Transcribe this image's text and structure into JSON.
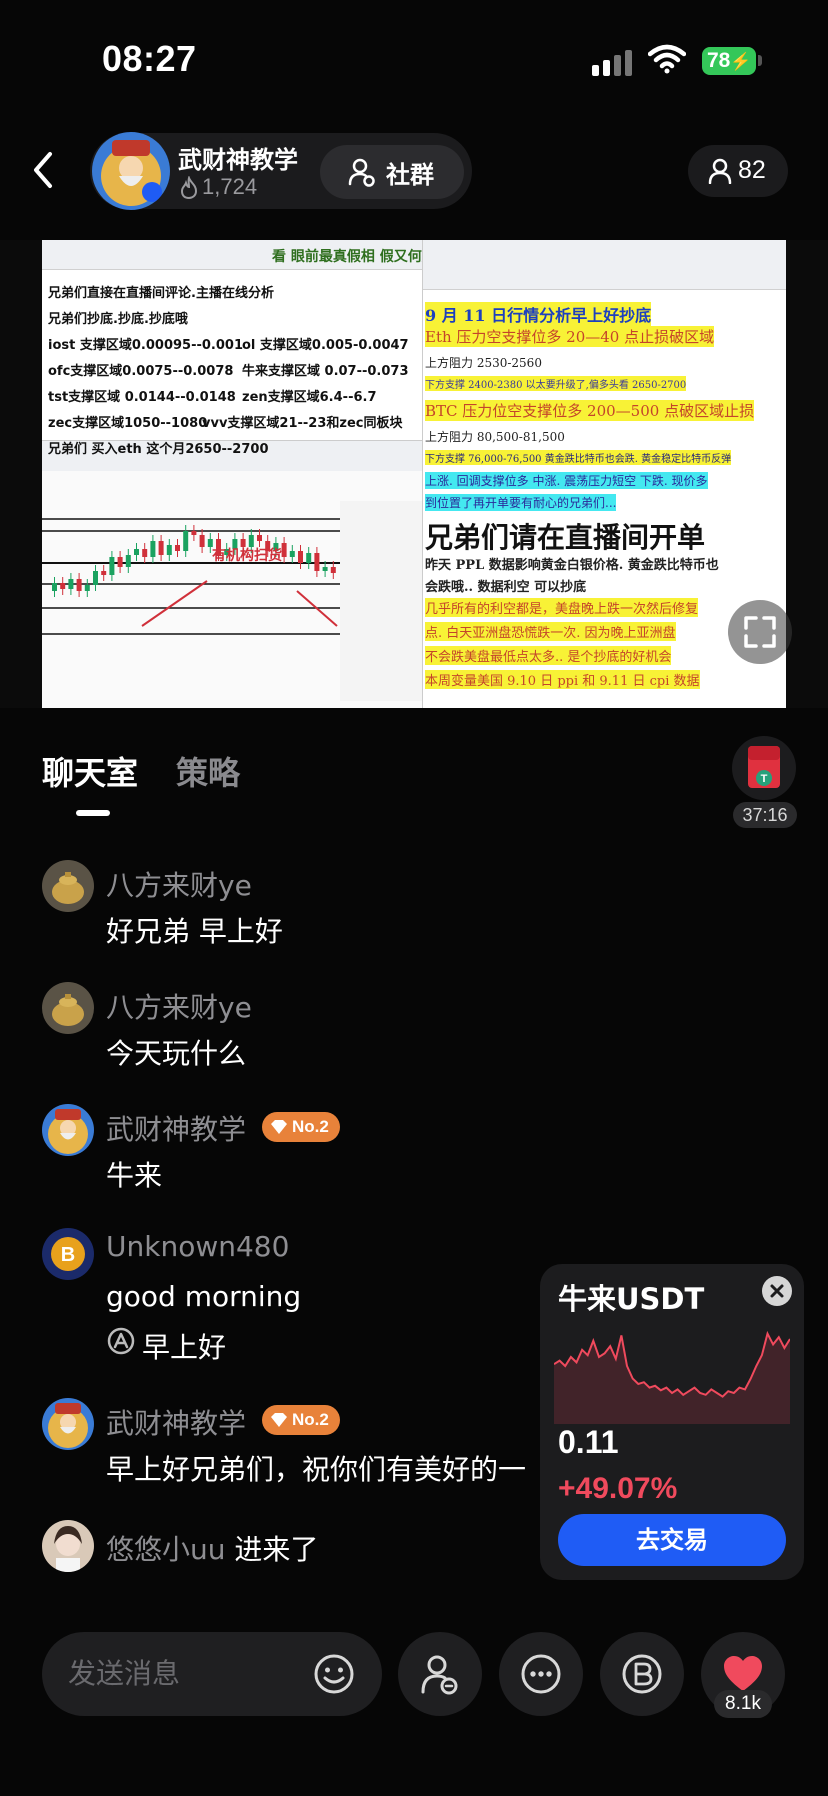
{
  "status_bar": {
    "time": "08:27",
    "battery": "78"
  },
  "header": {
    "host_name": "武财神教学",
    "host_fans": "1,724",
    "community_label": "社群",
    "viewer_count": "82"
  },
  "video": {
    "overlay_title": "看 眼前最真假相 假又何妨",
    "left_lines": [
      "兄弟们直接在直播间评论.主播在线分析",
      "兄弟们抄底.抄底.抄底哦",
      "iost 支撑区域0.00095--0.001",
      "ol 支撑区域0.005-0.0047",
      "ofc支撑区域0.0075--0.0078",
      "牛来支撑区域 0.07--0.073",
      "tst支撑区域 0.0144--0.0148",
      "zen支撑区域6.4--6.7",
      "zec支撑区域1050--1080",
      "vvv支撑区域21--23和zec同板块",
      "兄弟们 买入eth 这个月2650--2700"
    ],
    "chart_annotation": "有机构扫货",
    "right_lines": [
      "9 月 11 日行情分析早上好抄底",
      "Eth 压力空支撑位多 20—40 点止损破区域",
      "上方阻力 2530-2560",
      "下方支撑 2400-2380 以太要升级了,偏多头看 2650-2700",
      "BTC 压力位空支撑位多 200—500 点破区域止损",
      "上方阻力 80,500-81,500",
      "下方支撑 76,000-76,500 黄金跌比特币也会跌. 黄金稳定比特币反弹",
      "上涨. 回调支撑位多   中涨. 震荡压力短空   下跌. 现价多",
      "到位置了再开单要有耐心的兄弟们...",
      "兄弟们请在直播间开单",
      "昨天 PPL 数据影响黄金白银价格. 黄金跌比特币也",
      "会跌哦.. 数据利空  可以抄底",
      "几乎所有的利空都是，美盘晚上跌一次然后修复",
      "点. 白天亚洲盘恐慌跌一次. 因为晚上亚洲盘",
      "不会跌美盘最低点太多.. 是个抄底的好机会",
      "本周变量美国 9.10 日 ppi 和 9.11 日 cpi 数据"
    ]
  },
  "tabs": {
    "chat": "聊天室",
    "strategy": "策略"
  },
  "gift_timer": "37:16",
  "chat": [
    {
      "user": "八方来财ye",
      "text": "好兄弟  早上好"
    },
    {
      "user": "八方来财ye",
      "text": "今天玩什么"
    },
    {
      "user": "武财神教学",
      "badge": "No.2",
      "text": "牛来"
    },
    {
      "user": "Unknown480",
      "text": "good morning",
      "translation": "早上好"
    },
    {
      "user": "武财神教学",
      "badge": "No.2",
      "text": "早上好兄弟们，祝你们有美好的一"
    },
    {
      "user": "悠悠小uu",
      "text": "进来了"
    }
  ],
  "market_card": {
    "title": "牛来USDT",
    "price": "0.11",
    "change": "+49.07%",
    "trade_label": "去交易",
    "change_color": "#f04a5d",
    "sparkline": [
      0.62,
      0.66,
      0.6,
      0.7,
      0.64,
      0.78,
      0.72,
      0.88,
      0.7,
      0.74,
      0.82,
      0.68,
      0.94,
      0.6,
      0.46,
      0.4,
      0.42,
      0.36,
      0.38,
      0.33,
      0.36,
      0.3,
      0.34,
      0.28,
      0.32,
      0.36,
      0.3,
      0.28,
      0.34,
      0.3,
      0.26,
      0.32,
      0.3,
      0.36,
      0.34,
      0.46,
      0.6,
      0.72,
      0.96,
      0.84,
      0.92,
      0.8,
      0.9
    ]
  },
  "bottom_bar": {
    "input_placeholder": "发送消息",
    "like_count": "8.1k"
  },
  "colors": {
    "accent_blue": "#1f5cf5",
    "badge_orange": "#e8823a",
    "like_red": "#f04a5d",
    "battery_green": "#34c759"
  }
}
